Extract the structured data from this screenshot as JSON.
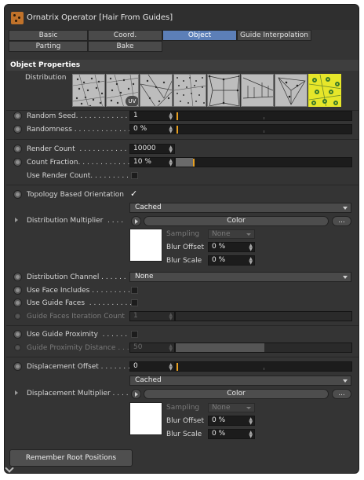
{
  "window": {
    "title": "Ornatrix Operator [Hair From Guides]"
  },
  "tabs": [
    {
      "label": "Basic"
    },
    {
      "label": "Coord."
    },
    {
      "label": "Object"
    },
    {
      "label": "Guide Interpolation"
    },
    {
      "label": "Parting"
    },
    {
      "label": "Bake"
    }
  ],
  "section": {
    "title": "Object Properties"
  },
  "distribution": {
    "label": "Distribution",
    "uv_badge": "UV",
    "selected_index": 8,
    "selected_color": "#e6e62a"
  },
  "random_seed": {
    "label": "Random Seed. . . . . . . . . . . . .",
    "value": "1"
  },
  "randomness": {
    "label": "Randomness . . . . . . . . . . . . .",
    "value": "0 %"
  },
  "render_count": {
    "label": "Render Count  . . . . . . . . . . . .",
    "value": "10000"
  },
  "count_fraction": {
    "label": "Count Fraction. . . . . . . . . . . .",
    "value": "10 %",
    "fraction": 0.1
  },
  "use_render_count": {
    "label": "Use Render Count. . . . . . . . . .",
    "checked": false
  },
  "topology": {
    "label": "Topology Based Orientation",
    "checked": true,
    "checkmark": "✓"
  },
  "dist_multiplier": {
    "mode": "Cached",
    "label": "Distribution Multiplier  . . . .",
    "button": "Color",
    "more": "...",
    "sampling_label": "Sampling",
    "sampling_value": "None",
    "blur_offset_label": "Blur Offset",
    "blur_offset_value": "0 %",
    "blur_scale_label": "Blur Scale",
    "blur_scale_value": "0 %"
  },
  "distribution_channel": {
    "label": "Distribution Channel . . . . . .",
    "value": "None"
  },
  "use_face_includes": {
    "label": "Use Face Includes . . . . . . . . .",
    "checked": false
  },
  "use_guide_faces": {
    "label": "Use Guide Faces  . . . . . . . . . .",
    "checked": false
  },
  "guide_faces_iter": {
    "label": "Guide Faces Iteration Count",
    "value": "1"
  },
  "use_guide_proximity": {
    "label": "Use Guide Proximity  . . . . . .",
    "checked": false
  },
  "guide_proximity_distance": {
    "label": "Guide Proximity Distance . . .",
    "value": "50"
  },
  "displacement_offset": {
    "label": "Displacement Offset . . . . . . .",
    "value": "0"
  },
  "disp_multiplier": {
    "mode": "Cached",
    "label": "Displacement Multiplier . . . .",
    "button": "Color",
    "more": "...",
    "sampling_label": "Sampling",
    "sampling_value": "None",
    "blur_offset_label": "Blur Offset",
    "blur_offset_value": "0 %",
    "blur_scale_label": "Blur Scale",
    "blur_scale_value": "0 %"
  },
  "remember_root": {
    "label": "Remember Root Positions"
  },
  "colors": {
    "accent_tab": "#5c7fb8",
    "slider_knob": "#e8a020",
    "panel_bg": "#343434"
  }
}
